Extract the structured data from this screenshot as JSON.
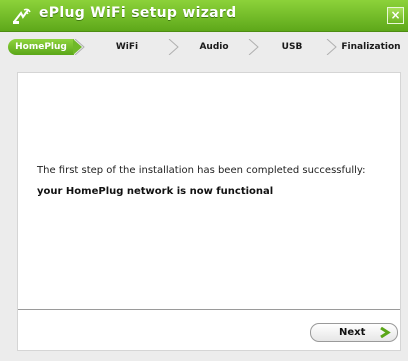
{
  "window": {
    "title": "ePlug WiFi setup wizard",
    "close_label": "×"
  },
  "steps": [
    {
      "label": "HomePlug",
      "active": true
    },
    {
      "label": "WiFi",
      "active": false
    },
    {
      "label": "Audio",
      "active": false
    },
    {
      "label": "USB",
      "active": false
    },
    {
      "label": "Finalization",
      "active": false
    }
  ],
  "content": {
    "message": "The first step of the installation has been completed successfully:",
    "status": "your HomePlug network is now functional"
  },
  "buttons": {
    "next_label": "Next"
  },
  "colors": {
    "accent": "#6cb522",
    "title_bar": "#5ea81a"
  }
}
